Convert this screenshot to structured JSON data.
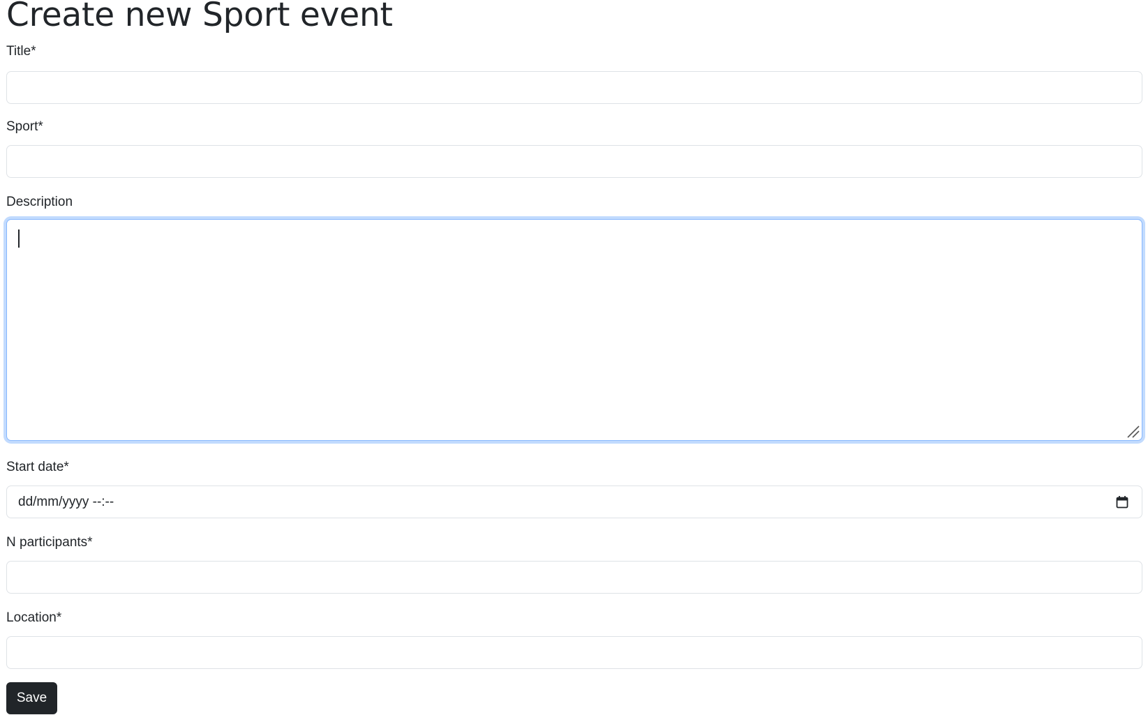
{
  "page": {
    "title": "Create new Sport event"
  },
  "form": {
    "title": {
      "label": "Title*",
      "value": ""
    },
    "sport": {
      "label": "Sport*",
      "value": ""
    },
    "description": {
      "label": "Description",
      "value": ""
    },
    "start_date": {
      "label": "Start date*",
      "placeholder": "dd/mm/yyyy --:--"
    },
    "n_participants": {
      "label": "N participants*",
      "value": ""
    },
    "location": {
      "label": "Location*",
      "value": ""
    },
    "save_label": "Save"
  },
  "icons": {
    "calendar": "calendar-icon",
    "resize": "resize-handle-icon"
  },
  "colors": {
    "text": "#212529",
    "border": "#dee2e6",
    "focus_border": "#86b7fe",
    "button_bg": "#212529",
    "button_text": "#ffffff"
  }
}
